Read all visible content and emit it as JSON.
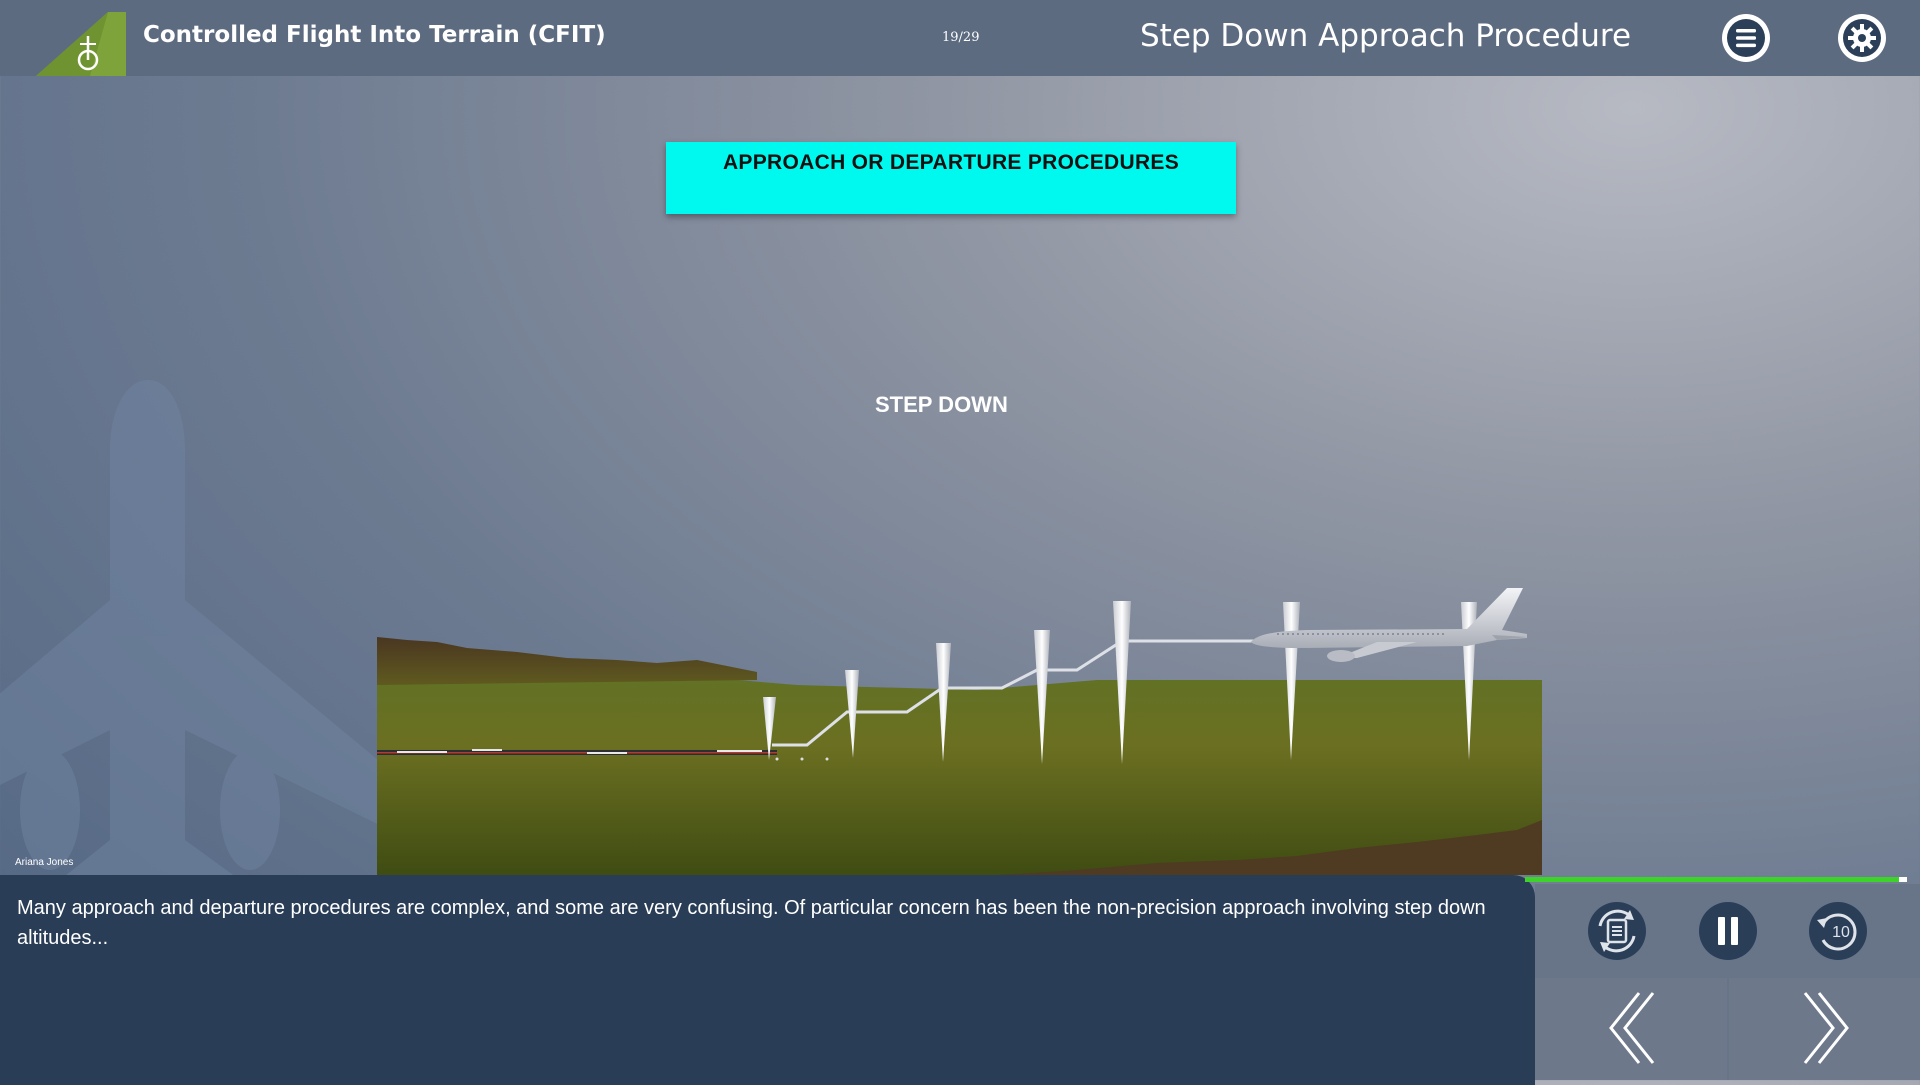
{
  "header": {
    "course_title": "Controlled Flight Into Terrain (CFIT)",
    "page_counter": "19/29",
    "slide_title": "Step Down Approach Procedure",
    "menu_icon": "hamburger-menu-icon",
    "settings_icon": "gear-icon"
  },
  "slide": {
    "banner": "APPROACH OR DEPARTURE PROCEDURES",
    "diagram_label": "STEP DOWN"
  },
  "author": "Ariana Jones",
  "caption": {
    "text": "Many approach and departure procedures are complex, and some are very confusing. Of particular concern has been the non-precision approach involving step down altitudes..."
  },
  "player": {
    "progress_percent": 98,
    "controls": [
      "transcript-icon",
      "pause-icon",
      "replay-10-icon",
      "previous-icon",
      "next-icon"
    ],
    "replay_seconds": "10"
  },
  "colors": {
    "header_bg": "#5d6b80",
    "banner_bg": "#00f9ee",
    "caption_bg": "#293d57",
    "progress": "#3ed32a",
    "logo": "#7ea33a"
  }
}
